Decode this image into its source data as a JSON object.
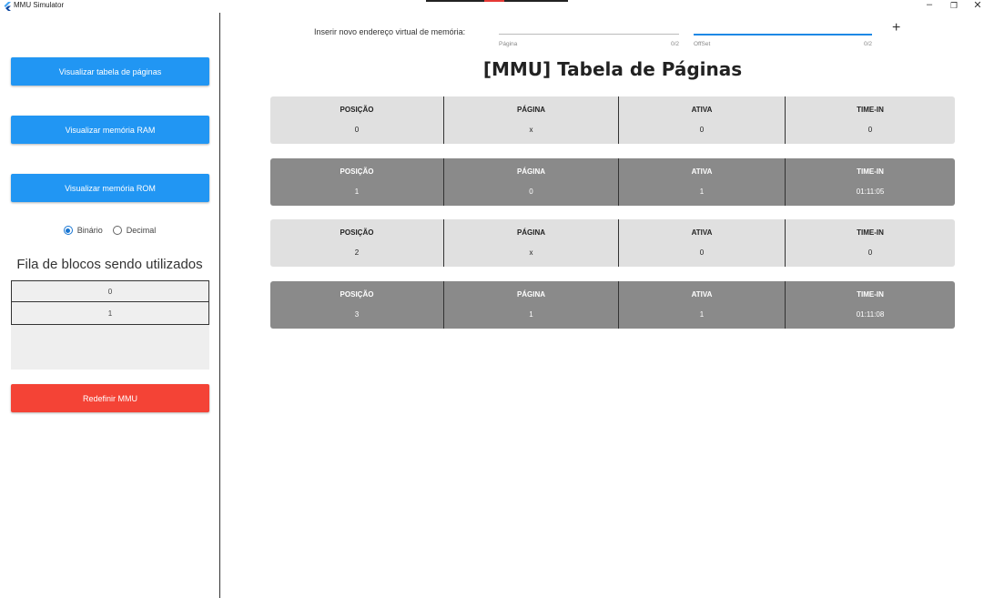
{
  "window": {
    "title": "MMU Simulator",
    "controls": {
      "minimize": "–",
      "maximize": "❐",
      "close": "✕"
    },
    "icon": "flutter-icon"
  },
  "sidebar": {
    "buttons": {
      "page_table": "Visualizar tabela de páginas",
      "ram": "Visualizar memória RAM",
      "rom": "Visualizar memória ROM",
      "reset": "Redefinir MMU"
    },
    "radio": {
      "options": [
        "Binário",
        "Decimal"
      ],
      "selected": "Binário"
    },
    "queue": {
      "title": "Fila de blocos sendo utilizados",
      "items": [
        "0",
        "1"
      ]
    }
  },
  "address_input": {
    "label": "Inserir novo endereço virtual de memória:",
    "page_field": {
      "hint": "Página",
      "value": "",
      "counter": "0/2"
    },
    "offset_field": {
      "hint": "OffSet",
      "value": "",
      "counter": "0/2"
    },
    "add_button": "+"
  },
  "main": {
    "title": "[MMU] Tabela de Páginas",
    "columns": [
      "POSIÇÃO",
      "PÁGINA",
      "ATIVA",
      "TIME-IN"
    ],
    "rows": [
      {
        "position": "0",
        "page": "x",
        "active": "0",
        "time_in": "0"
      },
      {
        "position": "1",
        "page": "0",
        "active": "1",
        "time_in": "01:11:05"
      },
      {
        "position": "2",
        "page": "x",
        "active": "0",
        "time_in": "0"
      },
      {
        "position": "3",
        "page": "1",
        "active": "1",
        "time_in": "01:11:08"
      }
    ]
  },
  "colors": {
    "button_blue": "#2196f3",
    "button_red": "#f44336",
    "row_inactive": "#e0e0e0",
    "row_active": "#8a8a8a"
  }
}
